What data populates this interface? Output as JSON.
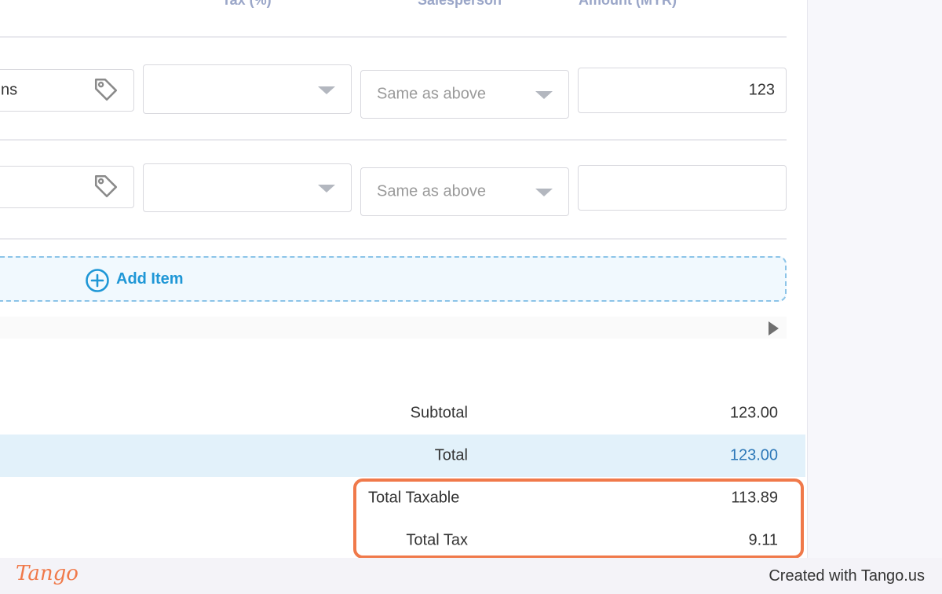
{
  "table": {
    "headers": {
      "tax": "Tax (%)",
      "salesperson": "Salesperson",
      "amount": "Amount (MYR)",
      "amount_required_mark": "*"
    },
    "rows": [
      {
        "item_text": "ns",
        "tax_value": "",
        "salesperson_placeholder": "Same as above",
        "amount": "123"
      },
      {
        "item_text": "",
        "tax_value": "",
        "salesperson_placeholder": "Same as above",
        "amount": ""
      }
    ],
    "add_item_label": "Add Item"
  },
  "summary": {
    "subtotal_label": "Subtotal",
    "subtotal_value": "123.00",
    "total_label": "Total",
    "total_value": "123.00",
    "total_taxable_label": "Total Taxable",
    "total_taxable_value": "113.89",
    "total_tax_label": "Total Tax",
    "total_tax_value": "9.11"
  },
  "footer": {
    "brand": "Tango",
    "credit": "Created with Tango.us"
  },
  "colors": {
    "accent_blue": "#1f97d6",
    "highlight_orange": "#f0794a",
    "total_row_bg": "#e2f1fa"
  },
  "icons": [
    "tag-icon",
    "dropdown-caret-icon",
    "add-circle-icon",
    "scroll-right-arrow-icon"
  ]
}
